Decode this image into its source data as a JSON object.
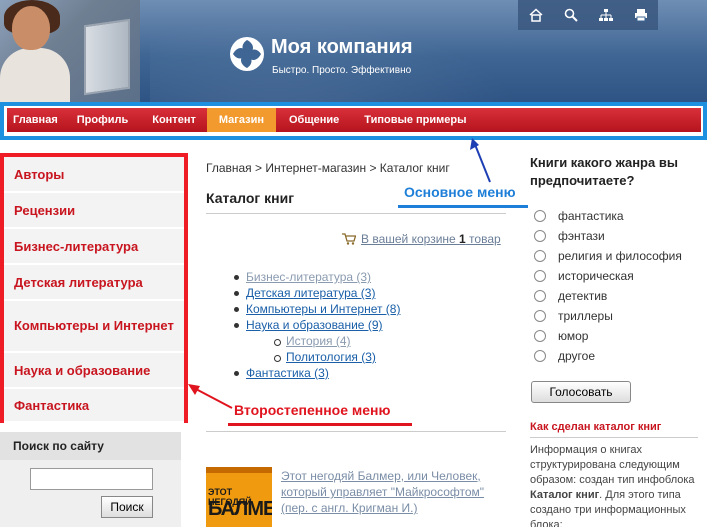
{
  "header": {
    "company": "Моя компания",
    "tagline": "Быстро. Просто. Эффективно",
    "icons": [
      "home-icon",
      "search-icon",
      "sitemap-icon",
      "print-icon"
    ]
  },
  "main_menu": {
    "items": [
      "Главная",
      "Профиль",
      "Контент",
      "Магазин",
      "Общение",
      "Типовые примеры"
    ],
    "active": "Магазин"
  },
  "left_menu": {
    "items": [
      "Авторы",
      "Рецензии",
      "Бизнес-литература",
      "Детская литература",
      "Компьютеры и Интернет",
      "Наука и образование",
      "Фантастика"
    ]
  },
  "search": {
    "title": "Поиск по сайту",
    "button": "Поиск"
  },
  "annotations": {
    "main_menu": "Основное меню",
    "secondary_menu": "Второстепенное меню"
  },
  "content": {
    "breadcrumb": "Главная > Интернет-магазин > Каталог книг",
    "title": "Каталог книг",
    "cart_prefix": "В вашей корзине ",
    "cart_count": "1",
    "cart_suffix": " товар",
    "categories": [
      "Бизнес-литература (3)",
      "Детская литература (3)",
      "Компьютеры и Интернет (8)",
      "Наука и образование (9)",
      "История (4)",
      "Политология (3)",
      "Фантастика (3)"
    ],
    "book": {
      "cover_line1": "ЭТОТ НЕГОДЯЙ",
      "cover_line2": "БАЛМЕР",
      "link": "Этот негодяй Балмер, или Человек, который управляет \"Майкрософтом\" (пер. с англ. Кригман И.)"
    }
  },
  "poll": {
    "question": "Книги какого жанра вы предпочитаете?",
    "options": [
      "фантастика",
      "фэнтази",
      "религия и философия",
      "историческая",
      "детектив",
      "триллеры",
      "юмор",
      "другое"
    ],
    "button": "Голосовать"
  },
  "howto": {
    "title": "Как сделан каталог книг",
    "text_1": "Информация о книгах структурирована следующим образом: создан тип инфоблока ",
    "text_bold": "Каталог книг",
    "text_2": ". Для этого типа создано три информационных блока:"
  },
  "colors": {
    "menu_red": "#c8151f",
    "menu_active": "#f29a2e",
    "frame_blue": "#1e90e0",
    "frame_red": "#ef1c25",
    "header_blue": "#3e6593"
  }
}
